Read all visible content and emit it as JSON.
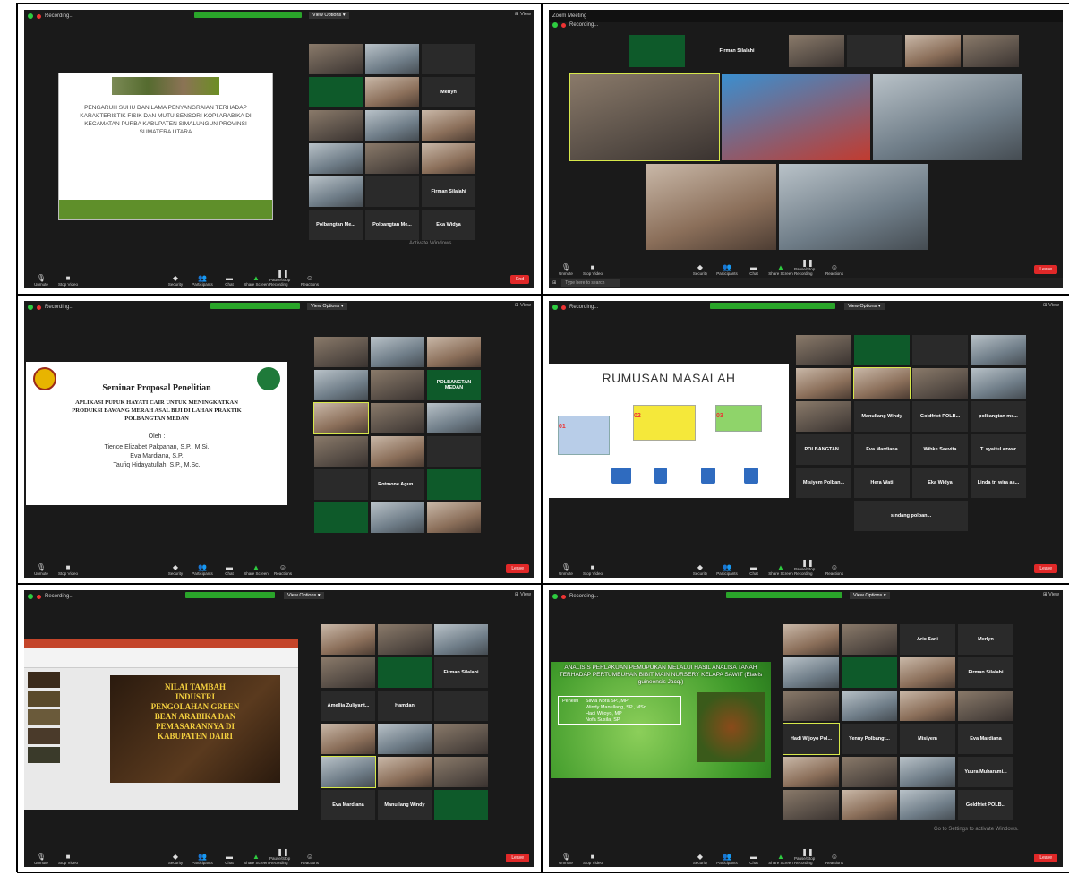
{
  "common": {
    "recording": "Recording...",
    "view_options": "View Options ▾",
    "view": "⊞ View",
    "activate": "Activate Windows",
    "activate_sub": "Go to Settings to activate Windows.",
    "end": "End",
    "leave": "Leave",
    "buttons": [
      "Unmute",
      "Stop Video",
      "Security",
      "Participants",
      "Chat",
      "Share Screen",
      "Pause/Stop Recording",
      "Reactions"
    ]
  },
  "p1": {
    "slide_title": "PENGARUH SUHU DAN LAMA PENYANGRAIAN TERHADAP KARAKTERISTIK FISIK DAN MUTU SENSORI KOPI ARABIKA DI KECAMATAN PURBA KABUPATEN SIMALUNGUN PROVINSI SUMATERA UTARA",
    "tiles": [
      "Firman Silalahi",
      "Merlyn",
      "Polbangtan Me...",
      "Eka Widya"
    ],
    "end": "End"
  },
  "p2": {
    "title": "Zoom Meeting",
    "firman": "Firman Silalahi",
    "search": "Type here to search",
    "leave": "Leave"
  },
  "p3": {
    "seminar": "Seminar Proposal Penelitian",
    "judul": "APLIKASI PUPUK HAYATI CAIR UNTUK MENINGKATKAN PRODUKSI BAWANG MERAH ASAL BIJI DI LAHAN PRAKTIK POLBANGTAN MEDAN",
    "oleh": "Oleh :",
    "authors": [
      "Tience Elizabet Pakpahan, S.P., M.Si.",
      "Eva Mardiana, S.P.",
      "Taufiq Hidayatullah, S.P., M.Sc."
    ],
    "tile_name": "Rotmone Agun...",
    "polbangtan": "POLBANGTAN MEDAN"
  },
  "p4": {
    "title": "RUMUSAN MASALAH",
    "boxes": [
      "01",
      "02",
      "03"
    ],
    "names": [
      "Manullang Windy",
      "Goldfriet POLB...",
      "polbangtan me...",
      "POLBANGTAN...",
      "Eva Mardiana",
      "Wibke Saevita",
      "T. syaiful azwar",
      "Misiyem Polban...",
      "Hera Wati",
      "Eka Widya",
      "Linda tri wira as...",
      "sindang polban..."
    ]
  },
  "p5": {
    "title": "NILAI TAMBAH INDUSTRI PENGOLAHAN GREEN BEAN ARABIKA DAN PEMASARANNYA DI KABUPATEN DAIRI",
    "names": [
      "Firman Silalahi",
      "Amellia Zuliyant...",
      "Hamdan",
      "Eva Mardiana",
      "Manullang Windy"
    ]
  },
  "p6": {
    "title": "ANALISIS PERLAKUAN PEMUPUKAN MELALUI HASIL ANALISA TANAH TERHADAP PERTUMBUHAN BIBIT MAIN NURSERY KELAPA SAWIT (Elaeis guineensis Jacq.)",
    "peneliti": "Peneliti",
    "researchers": [
      "Silvia Nora SP., MP",
      "Windy Manullang, SP., MSc",
      "Hadi Wijoyo, MP",
      "Nofa Susila, SP"
    ],
    "names": [
      "Aric Sani",
      "Merlyn",
      "Firman Silalahi",
      "Hadi Wijoyo Pol...",
      "Yenny Polbangt...",
      "Misiyem",
      "Eva Mardiana",
      "Yuura Muharami...",
      "Goldfriet POLB..."
    ]
  }
}
